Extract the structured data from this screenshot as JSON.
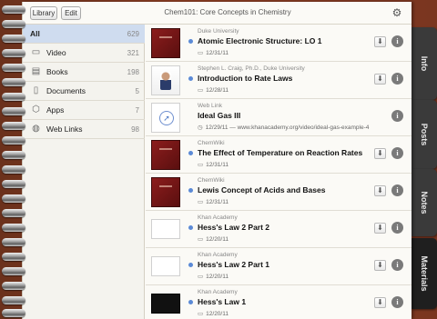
{
  "header": {
    "library_label": "Library",
    "edit_label": "Edit",
    "title": "Chem101: Core Concepts in Chemistry"
  },
  "sidebar": {
    "items": [
      {
        "label": "All",
        "count": "629",
        "icon": "none"
      },
      {
        "label": "Video",
        "count": "321",
        "icon": "video-icon"
      },
      {
        "label": "Books",
        "count": "198",
        "icon": "book-icon"
      },
      {
        "label": "Documents",
        "count": "5",
        "icon": "document-icon"
      },
      {
        "label": "Apps",
        "count": "7",
        "icon": "apps-icon"
      },
      {
        "label": "Web Links",
        "count": "98",
        "icon": "globe-icon"
      }
    ]
  },
  "materials": [
    {
      "source": "Duke University",
      "title": "Atomic Electronic Structure: LO 1",
      "date": "12/31/11",
      "thumb": "book",
      "meta_icon": "monitor-icon"
    },
    {
      "source": "Stephen L. Craig, Ph.D., Duke University",
      "title": "Introduction to Rate Laws",
      "date": "12/28/11",
      "thumb": "person",
      "meta_icon": "monitor-icon"
    },
    {
      "source": "Web Link",
      "title": "Ideal Gas III",
      "date": "12/29/11  —  www.khanacademy.org/video/ideal-gas-example-4",
      "thumb": "link",
      "meta_icon": "clock-icon"
    },
    {
      "source": "ChemWiki",
      "title": "The Effect of Temperature on Reaction Rates",
      "date": "12/31/11",
      "thumb": "book",
      "meta_icon": "monitor-icon"
    },
    {
      "source": "ChemWiki",
      "title": "Lewis Concept of Acids and Bases",
      "date": "12/31/11",
      "thumb": "book",
      "meta_icon": "monitor-icon"
    },
    {
      "source": "Khan Academy",
      "title": "Hess's Law 2 Part 2",
      "date": "12/20/11",
      "thumb": "blank",
      "meta_icon": "monitor-icon"
    },
    {
      "source": "Khan Academy",
      "title": "Hess's Law 2 Part 1",
      "date": "12/20/11",
      "thumb": "blank",
      "meta_icon": "monitor-icon"
    },
    {
      "source": "Khan Academy",
      "title": "Hess's Law 1",
      "date": "12/20/11",
      "thumb": "video",
      "meta_icon": "monitor-icon"
    }
  ],
  "tabs": [
    {
      "label": "Info"
    },
    {
      "label": "Posts"
    },
    {
      "label": "Notes"
    },
    {
      "label": "Materials",
      "active": true
    }
  ],
  "colors": {
    "selected_row": "#cfdcef",
    "unread_dot": "#5b8ad6",
    "cover": "#8a3d22"
  }
}
